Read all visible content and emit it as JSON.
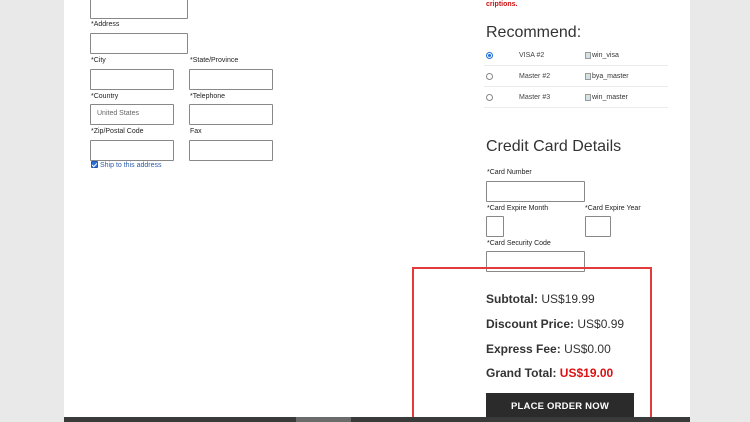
{
  "billing": {
    "address_label": "*Address",
    "city_label": "*City",
    "state_label": "*State/Province",
    "country_label": "*Country",
    "country_value": "United States",
    "telephone_label": "*Telephone",
    "zip_label": "*Zip/Postal Code",
    "fax_label": "Fax",
    "ship_label": "Ship to this address",
    "ship_checked": true
  },
  "notice": {
    "truncated_text": "criptions."
  },
  "recommend": {
    "title": "Recommend:",
    "options": [
      {
        "name": "VISA #2",
        "image_alt": "win_visa",
        "selected": true
      },
      {
        "name": "Master #2",
        "image_alt": "bya_master",
        "selected": false
      },
      {
        "name": "Master #3",
        "image_alt": "win_master",
        "selected": false
      }
    ]
  },
  "card": {
    "title": "Credit Card Details",
    "number_label": "*Card Number",
    "expire_month_label": "*Card Expire Month",
    "expire_year_label": "*Card Expire Year",
    "security_label": "*Card Security Code"
  },
  "summary": {
    "subtotal_label": "Subtotal:",
    "subtotal_value": "US$19.99",
    "discount_label": "Discount Price:",
    "discount_value": "US$0.99",
    "express_label": "Express Fee:",
    "express_value": "US$0.00",
    "grand_label": "Grand Total:",
    "grand_value": "US$19.00",
    "highlight_color": "#e23b3b"
  },
  "actions": {
    "place_order": "PLACE ORDER NOW"
  }
}
